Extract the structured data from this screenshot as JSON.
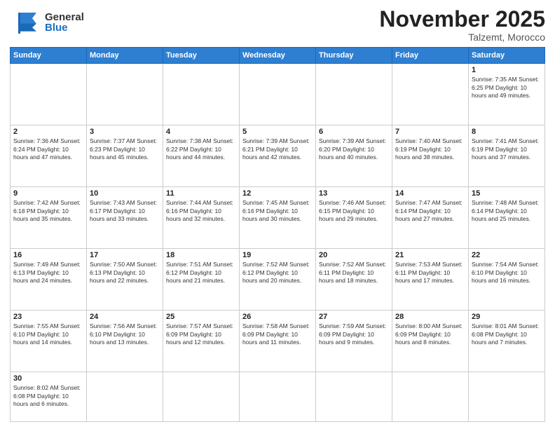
{
  "logo": {
    "general": "General",
    "blue": "Blue"
  },
  "title": "November 2025",
  "subtitle": "Talzemt, Morocco",
  "days_of_week": [
    "Sunday",
    "Monday",
    "Tuesday",
    "Wednesday",
    "Thursday",
    "Friday",
    "Saturday"
  ],
  "weeks": [
    [
      {
        "day": "",
        "info": ""
      },
      {
        "day": "",
        "info": ""
      },
      {
        "day": "",
        "info": ""
      },
      {
        "day": "",
        "info": ""
      },
      {
        "day": "",
        "info": ""
      },
      {
        "day": "",
        "info": ""
      },
      {
        "day": "1",
        "info": "Sunrise: 7:35 AM\nSunset: 6:25 PM\nDaylight: 10 hours and 49 minutes."
      }
    ],
    [
      {
        "day": "2",
        "info": "Sunrise: 7:36 AM\nSunset: 6:24 PM\nDaylight: 10 hours and 47 minutes."
      },
      {
        "day": "3",
        "info": "Sunrise: 7:37 AM\nSunset: 6:23 PM\nDaylight: 10 hours and 45 minutes."
      },
      {
        "day": "4",
        "info": "Sunrise: 7:38 AM\nSunset: 6:22 PM\nDaylight: 10 hours and 44 minutes."
      },
      {
        "day": "5",
        "info": "Sunrise: 7:39 AM\nSunset: 6:21 PM\nDaylight: 10 hours and 42 minutes."
      },
      {
        "day": "6",
        "info": "Sunrise: 7:39 AM\nSunset: 6:20 PM\nDaylight: 10 hours and 40 minutes."
      },
      {
        "day": "7",
        "info": "Sunrise: 7:40 AM\nSunset: 6:19 PM\nDaylight: 10 hours and 38 minutes."
      },
      {
        "day": "8",
        "info": "Sunrise: 7:41 AM\nSunset: 6:19 PM\nDaylight: 10 hours and 37 minutes."
      }
    ],
    [
      {
        "day": "9",
        "info": "Sunrise: 7:42 AM\nSunset: 6:18 PM\nDaylight: 10 hours and 35 minutes."
      },
      {
        "day": "10",
        "info": "Sunrise: 7:43 AM\nSunset: 6:17 PM\nDaylight: 10 hours and 33 minutes."
      },
      {
        "day": "11",
        "info": "Sunrise: 7:44 AM\nSunset: 6:16 PM\nDaylight: 10 hours and 32 minutes."
      },
      {
        "day": "12",
        "info": "Sunrise: 7:45 AM\nSunset: 6:16 PM\nDaylight: 10 hours and 30 minutes."
      },
      {
        "day": "13",
        "info": "Sunrise: 7:46 AM\nSunset: 6:15 PM\nDaylight: 10 hours and 29 minutes."
      },
      {
        "day": "14",
        "info": "Sunrise: 7:47 AM\nSunset: 6:14 PM\nDaylight: 10 hours and 27 minutes."
      },
      {
        "day": "15",
        "info": "Sunrise: 7:48 AM\nSunset: 6:14 PM\nDaylight: 10 hours and 25 minutes."
      }
    ],
    [
      {
        "day": "16",
        "info": "Sunrise: 7:49 AM\nSunset: 6:13 PM\nDaylight: 10 hours and 24 minutes."
      },
      {
        "day": "17",
        "info": "Sunrise: 7:50 AM\nSunset: 6:13 PM\nDaylight: 10 hours and 22 minutes."
      },
      {
        "day": "18",
        "info": "Sunrise: 7:51 AM\nSunset: 6:12 PM\nDaylight: 10 hours and 21 minutes."
      },
      {
        "day": "19",
        "info": "Sunrise: 7:52 AM\nSunset: 6:12 PM\nDaylight: 10 hours and 20 minutes."
      },
      {
        "day": "20",
        "info": "Sunrise: 7:52 AM\nSunset: 6:11 PM\nDaylight: 10 hours and 18 minutes."
      },
      {
        "day": "21",
        "info": "Sunrise: 7:53 AM\nSunset: 6:11 PM\nDaylight: 10 hours and 17 minutes."
      },
      {
        "day": "22",
        "info": "Sunrise: 7:54 AM\nSunset: 6:10 PM\nDaylight: 10 hours and 16 minutes."
      }
    ],
    [
      {
        "day": "23",
        "info": "Sunrise: 7:55 AM\nSunset: 6:10 PM\nDaylight: 10 hours and 14 minutes."
      },
      {
        "day": "24",
        "info": "Sunrise: 7:56 AM\nSunset: 6:10 PM\nDaylight: 10 hours and 13 minutes."
      },
      {
        "day": "25",
        "info": "Sunrise: 7:57 AM\nSunset: 6:09 PM\nDaylight: 10 hours and 12 minutes."
      },
      {
        "day": "26",
        "info": "Sunrise: 7:58 AM\nSunset: 6:09 PM\nDaylight: 10 hours and 11 minutes."
      },
      {
        "day": "27",
        "info": "Sunrise: 7:59 AM\nSunset: 6:09 PM\nDaylight: 10 hours and 9 minutes."
      },
      {
        "day": "28",
        "info": "Sunrise: 8:00 AM\nSunset: 6:09 PM\nDaylight: 10 hours and 8 minutes."
      },
      {
        "day": "29",
        "info": "Sunrise: 8:01 AM\nSunset: 6:08 PM\nDaylight: 10 hours and 7 minutes."
      }
    ],
    [
      {
        "day": "30",
        "info": "Sunrise: 8:02 AM\nSunset: 6:08 PM\nDaylight: 10 hours and 6 minutes."
      },
      {
        "day": "",
        "info": ""
      },
      {
        "day": "",
        "info": ""
      },
      {
        "day": "",
        "info": ""
      },
      {
        "day": "",
        "info": ""
      },
      {
        "day": "",
        "info": ""
      },
      {
        "day": "",
        "info": ""
      }
    ]
  ],
  "colors": {
    "header_bg": "#2e7fd1",
    "header_text": "#ffffff",
    "border": "#cccccc",
    "empty_bg": "#f5f5f5"
  }
}
